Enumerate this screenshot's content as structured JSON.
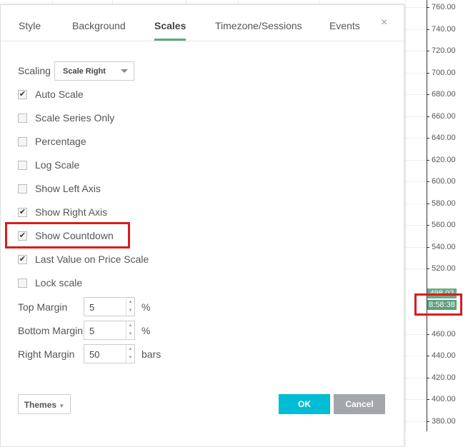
{
  "dialog": {
    "tabs": [
      {
        "label": "Style"
      },
      {
        "label": "Background"
      },
      {
        "label": "Scales",
        "active": true
      },
      {
        "label": "Timezone/Sessions"
      },
      {
        "label": "Events"
      }
    ],
    "close_icon": "×",
    "scaling": {
      "label": "Scaling",
      "value": "Scale Right"
    },
    "options": [
      {
        "label": "Auto Scale",
        "checked": true
      },
      {
        "label": "Scale Series Only",
        "checked": false
      },
      {
        "label": "Percentage",
        "checked": false
      },
      {
        "label": "Log Scale",
        "checked": false
      },
      {
        "label": "Show Left Axis",
        "checked": false
      },
      {
        "label": "Show Right Axis",
        "checked": true
      },
      {
        "label": "Show Countdown",
        "checked": true
      },
      {
        "label": "Last Value on Price Scale",
        "checked": true
      },
      {
        "label": "Lock scale",
        "checked": false
      }
    ],
    "margins": [
      {
        "label": "Top Margin",
        "value": "5",
        "unit": "%"
      },
      {
        "label": "Bottom Margin",
        "value": "5",
        "unit": "%"
      },
      {
        "label": "Right Margin",
        "value": "50",
        "unit": "bars"
      }
    ],
    "themes_label": "Themes",
    "ok_label": "OK",
    "cancel_label": "Cancel"
  },
  "price_scale": {
    "labels": [
      "760.00",
      "740.00",
      "720.00",
      "700.00",
      "680.00",
      "660.00",
      "640.00",
      "620.00",
      "600.00",
      "580.00",
      "560.00",
      "540.00",
      "520.00",
      "460.00",
      "440.00",
      "420.00",
      "400.00",
      "380.00"
    ],
    "last_value": "498.02",
    "countdown": "8:58:38"
  },
  "colors": {
    "accent": "#5fa882",
    "ok": "#00bcd4",
    "cancel": "#a3a6ab",
    "highlight": "#d91c1c",
    "price_tag": "#6da989"
  }
}
